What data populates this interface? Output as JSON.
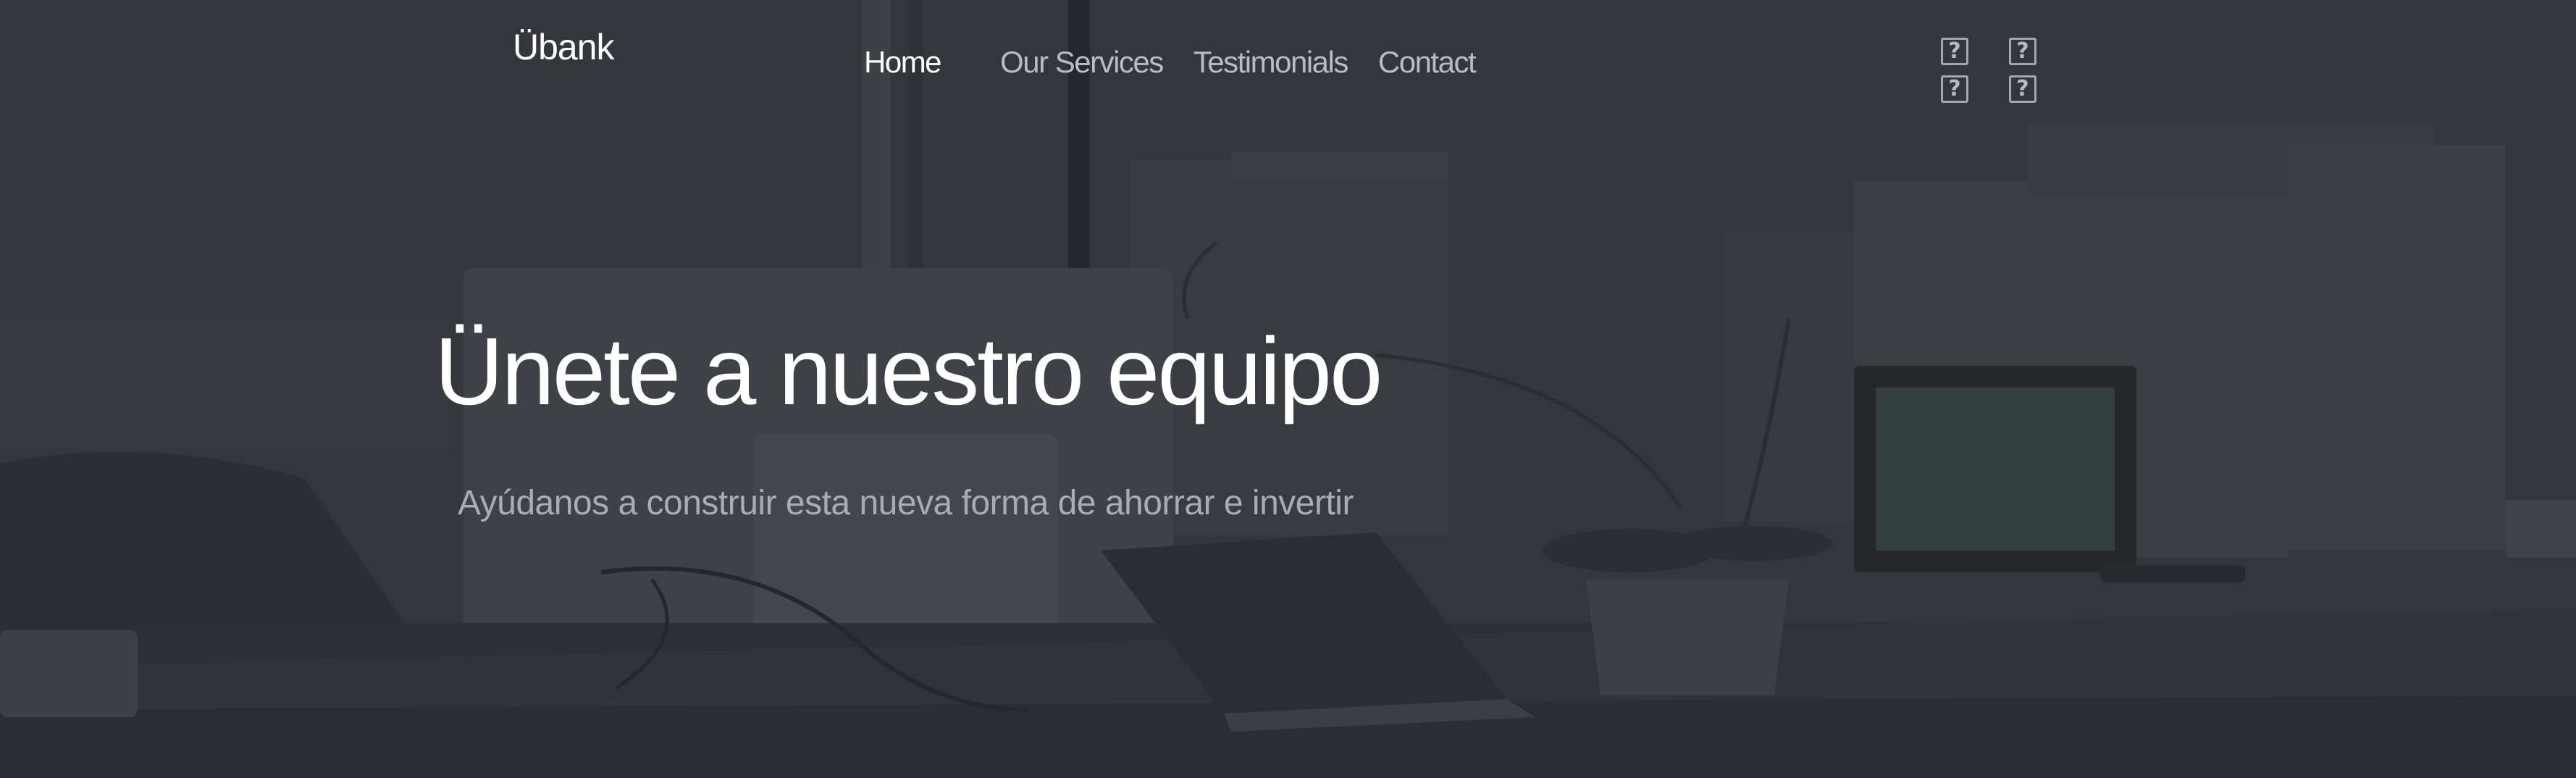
{
  "brand": {
    "logo": "Übank"
  },
  "nav": {
    "items": [
      {
        "label": "Home",
        "active": true
      },
      {
        "label": "Our Services",
        "active": false
      },
      {
        "label": "Testimonials",
        "active": false
      },
      {
        "label": "Contact",
        "active": false
      }
    ]
  },
  "header_icons": [
    {
      "name": "unknown-icon",
      "glyph": "?"
    },
    {
      "name": "unknown-icon",
      "glyph": "?"
    },
    {
      "name": "unknown-icon",
      "glyph": "?"
    },
    {
      "name": "unknown-icon",
      "glyph": "?"
    }
  ],
  "hero": {
    "title": "Ünete a nuestro equipo",
    "subtitle": "Ayúdanos a construir esta nueva forma de ahorrar e invertir"
  },
  "colors": {
    "overlay": "#32363b",
    "nav_active": "#ffffff",
    "nav_inactive": "#b8bcc1",
    "subtitle": "#a9adb2"
  }
}
